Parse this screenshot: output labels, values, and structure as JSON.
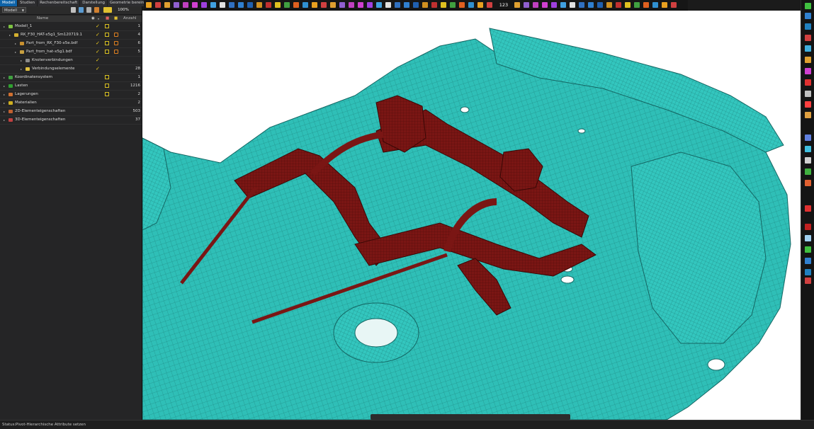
{
  "tabs": [
    {
      "label": "Modell",
      "active": true
    },
    {
      "label": "Studien",
      "active": false
    },
    {
      "label": "Rechenbereitschaft",
      "active": false
    },
    {
      "label": "Darstellung",
      "active": false
    },
    {
      "label": "Geometrie bereinigen",
      "active": false
    }
  ],
  "panel_toolbar": {
    "model_select": "Modell",
    "zoom": "100%"
  },
  "tree_header": {
    "name": "Name",
    "anzahl": "Anzahl"
  },
  "tree": [
    {
      "label": "Modell_1",
      "count": "1",
      "indent": 0,
      "icon_color": "#7dc242",
      "check": true,
      "sq": true,
      "sq2": false
    },
    {
      "label": "RK_F30_HAT-x5g1_Sm120719.1",
      "count": "4",
      "indent": 1,
      "icon_color": "#d4b030",
      "check": true,
      "sq": true,
      "sq2": true
    },
    {
      "label": "Part_from_RK_F30-x5e.bdf",
      "count": "6",
      "indent": 2,
      "icon_color": "#c89030",
      "check": true,
      "sq": true,
      "sq2": true
    },
    {
      "label": "Part_from_hat-x5g1.bdf",
      "count": "5",
      "indent": 2,
      "icon_color": "#c8a040",
      "check": true,
      "sq": true,
      "sq2": true
    },
    {
      "label": "Knotenverbindungen",
      "count": "",
      "indent": 3,
      "icon_color": "#8a8a8a",
      "check": true,
      "sq": false,
      "sq2": false
    },
    {
      "label": "Verbindungselemente",
      "count": "28",
      "indent": 3,
      "icon_color": "#e0c040",
      "check": true,
      "sq": false,
      "sq2": false
    },
    {
      "label": "Koordinatensystem",
      "count": "1",
      "indent": 0,
      "icon_color": "#40a040",
      "check": false,
      "sq": true,
      "sq2": false
    },
    {
      "label": "Lasten",
      "count": "1216",
      "indent": 0,
      "icon_color": "#30a030",
      "check": false,
      "sq": true,
      "sq2": false
    },
    {
      "label": "Lagerungen",
      "count": "2",
      "indent": 0,
      "icon_color": "#d07030",
      "check": false,
      "sq": true,
      "sq2": false
    },
    {
      "label": "Materialien",
      "count": "2",
      "indent": 0,
      "icon_color": "#d0b020",
      "check": false,
      "sq": false,
      "sq2": false
    },
    {
      "label": "2D-Elementeigenschaften",
      "count": "503",
      "indent": 0,
      "icon_color": "#c06030",
      "check": false,
      "sq": false,
      "sq2": false
    },
    {
      "label": "3D-Elementeigenschaften",
      "count": "37",
      "indent": 0,
      "icon_color": "#c04040",
      "check": false,
      "sq": false,
      "sq2": false
    }
  ],
  "toolbar_counter": "123",
  "status": {
    "label": "Status:",
    "text": "Pivot-Hierarchische Attribute setzen"
  },
  "colors": {
    "mesh_body": "#2fbfb7",
    "mesh_line": "#1b7f7a",
    "subframe": "#7a1614",
    "accent_blue": "#0e63a8"
  },
  "icons": {
    "top_toolbar": [
      "sphere-icon",
      "cube-icon",
      "rotate-icon",
      "view-icon",
      "render-icon",
      "select-icon",
      "mesh-icon",
      "node-icon",
      "element-icon",
      "measure-icon",
      "counter-icon",
      "clip-icon",
      "section-icon",
      "color-icon",
      "settings-icon"
    ],
    "right_toolbar": [
      "cube-icon",
      "layers-icon",
      "grid-icon",
      "measure-icon",
      "chart-icon",
      "arrow-icon",
      "tool-icon",
      "magnet-icon",
      "view-icon",
      "sphere-icon",
      "stack-icon",
      "palette-icon",
      "globe-icon"
    ]
  }
}
